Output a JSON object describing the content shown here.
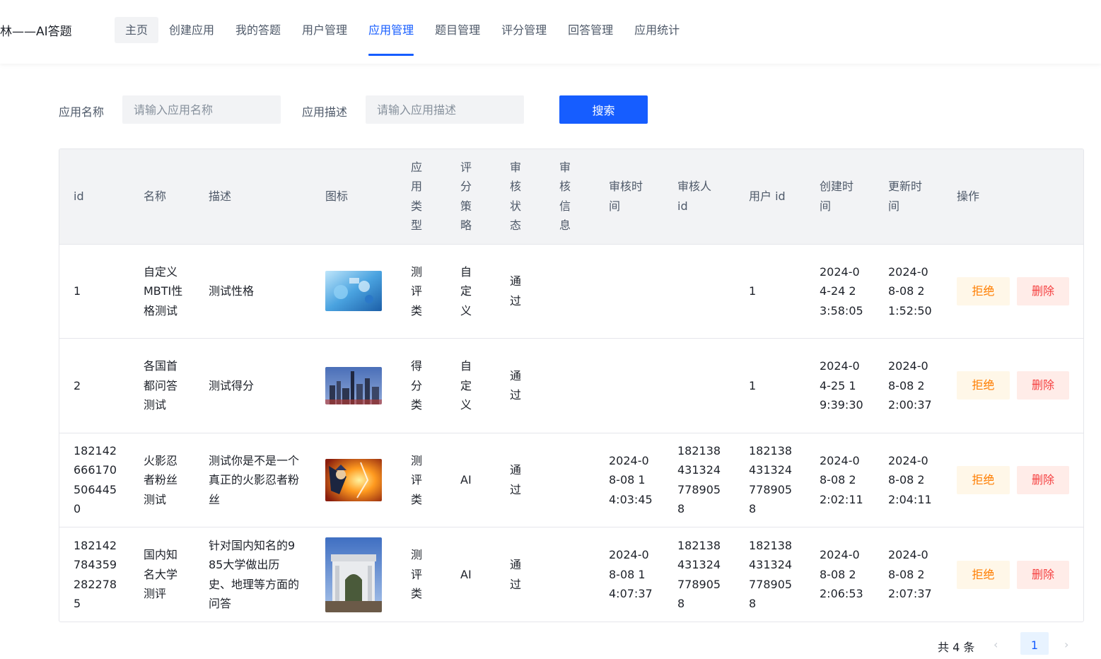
{
  "header": {
    "title": "林——AI答题",
    "nav": [
      {
        "label": "主页"
      },
      {
        "label": "创建应用"
      },
      {
        "label": "我的答题"
      },
      {
        "label": "用户管理"
      },
      {
        "label": "应用管理"
      },
      {
        "label": "题目管理"
      },
      {
        "label": "评分管理"
      },
      {
        "label": "回答管理"
      },
      {
        "label": "应用统计"
      }
    ],
    "active_nav": "应用管理"
  },
  "search": {
    "app_name_label": "应用名称",
    "app_name_placeholder": "请输入应用名称",
    "app_name_value": "",
    "app_desc_label": "应用描述",
    "app_desc_placeholder": "请输入应用描述",
    "app_desc_value": "",
    "button_label": "搜索"
  },
  "table": {
    "columns": [
      "id",
      "名称",
      "描述",
      "图标",
      "应用类型",
      "评分策略",
      "审核状态",
      "审核信息",
      "审核时间",
      "审核人 id",
      "用户 id",
      "创建时间",
      "更新时间",
      "操作"
    ],
    "rows": [
      {
        "id": "1",
        "name": "自定义MBTI性格测试",
        "desc": "测试性格",
        "icon": "mbti-app-icon",
        "app_type": "测评类",
        "strategy": "自定义",
        "review_status": "通过",
        "review_msg": "",
        "review_time": "",
        "reviewer_id": "",
        "user_id": "1",
        "create_time": "2024-04-24 23:58:05",
        "update_time": "2024-08-08 21:52:50"
      },
      {
        "id": "2",
        "name": "各国首都问答测试",
        "desc": "测试得分",
        "icon": "city-skyline-icon",
        "app_type": "得分类",
        "strategy": "自定义",
        "review_status": "通过",
        "review_msg": "",
        "review_time": "",
        "reviewer_id": "",
        "user_id": "1",
        "create_time": "2024-04-25 19:39:30",
        "update_time": "2024-08-08 22:00:37"
      },
      {
        "id": "1821426661705064450",
        "name": "火影忍者粉丝测试",
        "desc": "测试你是不是一个真正的火影忍者粉丝",
        "icon": "naruto-icon",
        "app_type": "测评类",
        "strategy": "AI",
        "review_status": "通过",
        "review_msg": "",
        "review_time": "2024-08-08 14:03:45",
        "reviewer_id": "1821384313247789058",
        "user_id": "1821384313247789058",
        "create_time": "2024-08-08 22:02:11",
        "update_time": "2024-08-08 22:04:11"
      },
      {
        "id": "1821427843592822785",
        "name": "国内知名大学测评",
        "desc": "针对国内知名的985大学做出历史、地理等方面的问答",
        "icon": "university-gate-icon",
        "app_type": "测评类",
        "strategy": "AI",
        "review_status": "通过",
        "review_msg": "",
        "review_time": "2024-08-08 14:07:37",
        "reviewer_id": "1821384313247789058",
        "user_id": "1821384313247789058",
        "create_time": "2024-08-08 22:06:53",
        "update_time": "2024-08-08 22:07:37"
      }
    ],
    "reject_label": "拒绝",
    "delete_label": "删除"
  },
  "pagination": {
    "total_text": "共 4 条",
    "current_page": "1",
    "prev_icon": "chevron-left-icon",
    "next_icon": "chevron-right-icon"
  },
  "colors": {
    "primary": "#165dff",
    "reject_bg": "#fff7e8",
    "reject_text": "#ff7d00",
    "delete_bg": "#ffece8",
    "delete_text": "#f53f3f"
  }
}
